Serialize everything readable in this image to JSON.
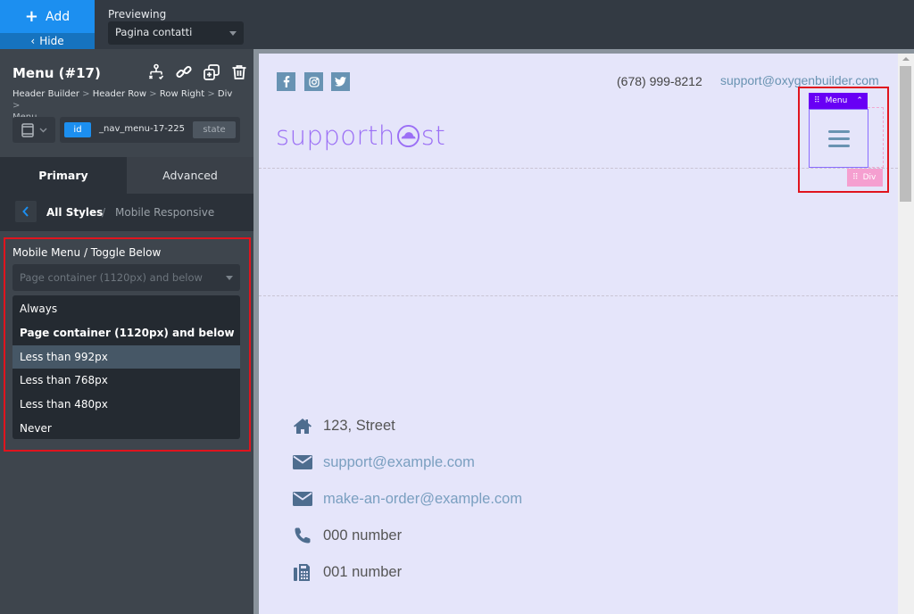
{
  "topbar": {
    "add_label": "Add",
    "hide_label": "Hide",
    "previewing_label": "Previewing",
    "preview_page": "Pagina contatti"
  },
  "sidebar": {
    "title": "Menu (#17)",
    "breadcrumb": [
      "Header Builder",
      "Header Row",
      "Row Right",
      "Div",
      "Menu"
    ],
    "id_badge": "id",
    "id_value": "_nav_menu-17-225",
    "state_label": "state",
    "tabs": [
      {
        "label": "Primary",
        "active": true
      },
      {
        "label": "Advanced",
        "active": false
      }
    ],
    "styles_nav": {
      "root": "All Styles",
      "separator": "/",
      "current": "Mobile Responsive"
    },
    "setting": {
      "label": "Mobile Menu / Toggle Below",
      "selected_value": "Page container (1120px) and below",
      "options": [
        {
          "label": "Always",
          "selected": false,
          "hover": false
        },
        {
          "label": "Page container (1120px) and below",
          "selected": true,
          "hover": false
        },
        {
          "label": "Less than 992px",
          "selected": false,
          "hover": true
        },
        {
          "label": "Less than 768px",
          "selected": false,
          "hover": false
        },
        {
          "label": "Less than 480px",
          "selected": false,
          "hover": false
        },
        {
          "label": "Never",
          "selected": false,
          "hover": false
        }
      ]
    }
  },
  "canvas": {
    "social": [
      "facebook",
      "instagram",
      "twitter"
    ],
    "phone": "(678) 999-8212",
    "email": "support@oxygenbuilder.com",
    "logo_prefix": "supporth",
    "logo_suffix": "st",
    "menu_tag": "Menu",
    "div_tag": "Div",
    "contacts": [
      {
        "icon": "home-icon",
        "text": "123, Street",
        "link": false
      },
      {
        "icon": "envelope-icon",
        "text": "support@example.com",
        "link": true
      },
      {
        "icon": "envelope-icon",
        "text": "make-an-order@example.com",
        "link": true
      },
      {
        "icon": "phone-icon",
        "text": "000 number",
        "link": false
      },
      {
        "icon": "fax-icon",
        "text": "001 number",
        "link": false
      }
    ]
  },
  "colors": {
    "accent_blue": "#1c8ff0",
    "highlight_red": "#e0141e",
    "menu_purple": "#6800f5",
    "div_pink": "#f59fd0",
    "logo_purple": "#9b6ff5",
    "canvas_bg": "#e5e5fa"
  }
}
